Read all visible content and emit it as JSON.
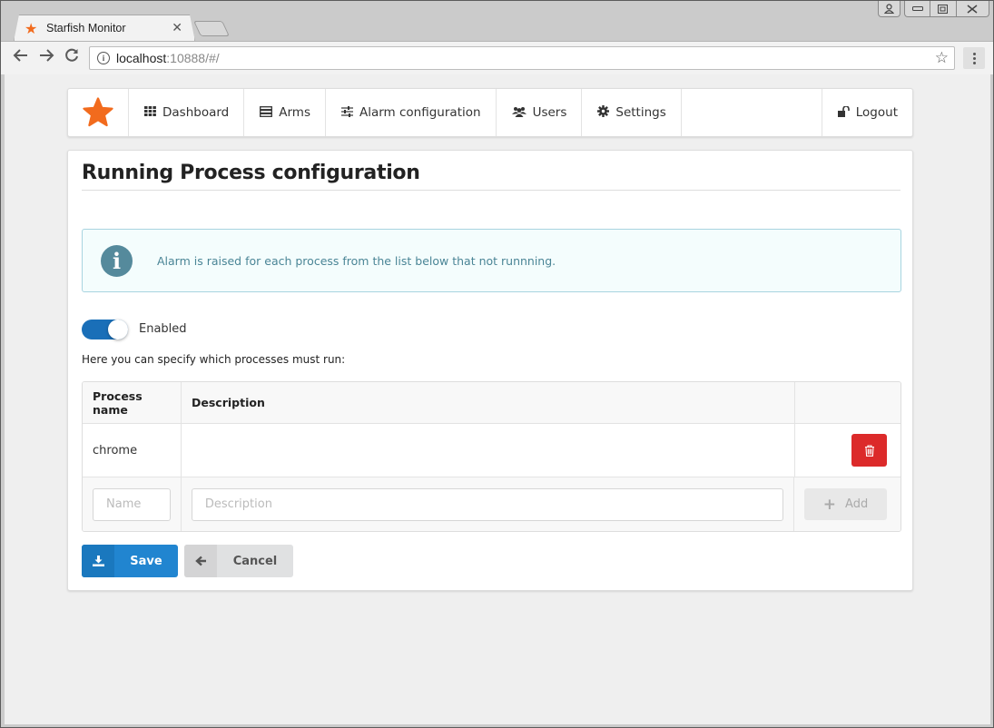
{
  "browser": {
    "tab_title": "Starfish Monitor",
    "tab_favicon": "star-icon",
    "url_host": "localhost",
    "url_rest": ":10888/#/",
    "controls": {
      "back": "back-arrow-icon",
      "forward": "forward-arrow-icon",
      "reload": "reload-icon",
      "bookmark": "star-outline-icon",
      "menu": "more-vert-icon"
    }
  },
  "navbar": {
    "brand_icon": "star-icon",
    "items": [
      {
        "label": "Dashboard",
        "icon": "grid-icon"
      },
      {
        "label": "Arms",
        "icon": "server-icon"
      },
      {
        "label": "Alarm configuration",
        "icon": "sliders-icon"
      },
      {
        "label": "Users",
        "icon": "users-icon"
      },
      {
        "label": "Settings",
        "icon": "gear-icon"
      }
    ],
    "logout": {
      "label": "Logout",
      "icon": "unlock-icon"
    }
  },
  "page": {
    "title": "Running Process configuration",
    "alert_text": "Alarm is raised for each process from the list below that not runnning.",
    "toggle": {
      "label": "Enabled",
      "on": true
    },
    "hint": "Here you can specify which processes must run:",
    "table": {
      "headers": [
        "Process name",
        "Description",
        ""
      ],
      "rows": [
        {
          "name": "chrome",
          "description": ""
        }
      ],
      "new_row": {
        "name_placeholder": "Name",
        "description_placeholder": "Description",
        "add_label": "Add"
      }
    },
    "buttons": {
      "save_label": "Save",
      "cancel_label": "Cancel"
    }
  },
  "colors": {
    "brand": "#f26b1d",
    "primary": "#2185d0",
    "danger": "#dc2a2a",
    "info_text": "#4a8596",
    "toggle_on": "#1a6fb8"
  }
}
